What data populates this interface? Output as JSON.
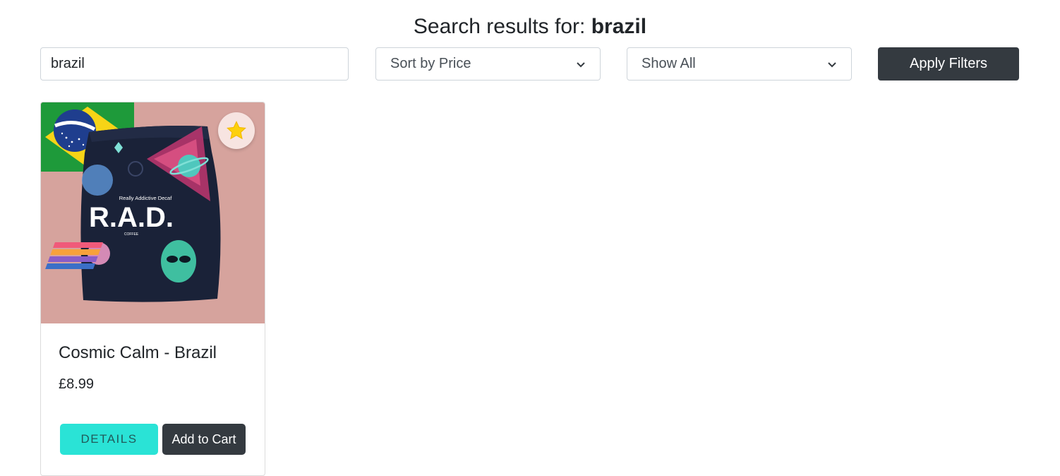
{
  "header": {
    "prefix": "Search results for:",
    "query": "brazil"
  },
  "filters": {
    "search_value": "brazil",
    "sort_selected": "Sort by Price",
    "show_selected": "Show All",
    "apply_label": "Apply Filters"
  },
  "product": {
    "name": "Cosmic Calm - Brazil",
    "price": "£8.99",
    "details_label": "DETAILS",
    "cart_label": "Add to Cart",
    "bag_tagline": "Really Addictive Decaf",
    "bag_brand": "R.A.D.",
    "bag_subbrand": "COFFEE",
    "favorite_icon": "star-icon"
  },
  "colors": {
    "dark_button": "#343a40",
    "details_button": "#2ae3d6",
    "image_background": "#d6a39d",
    "favorite_star": "#fdd00c"
  }
}
